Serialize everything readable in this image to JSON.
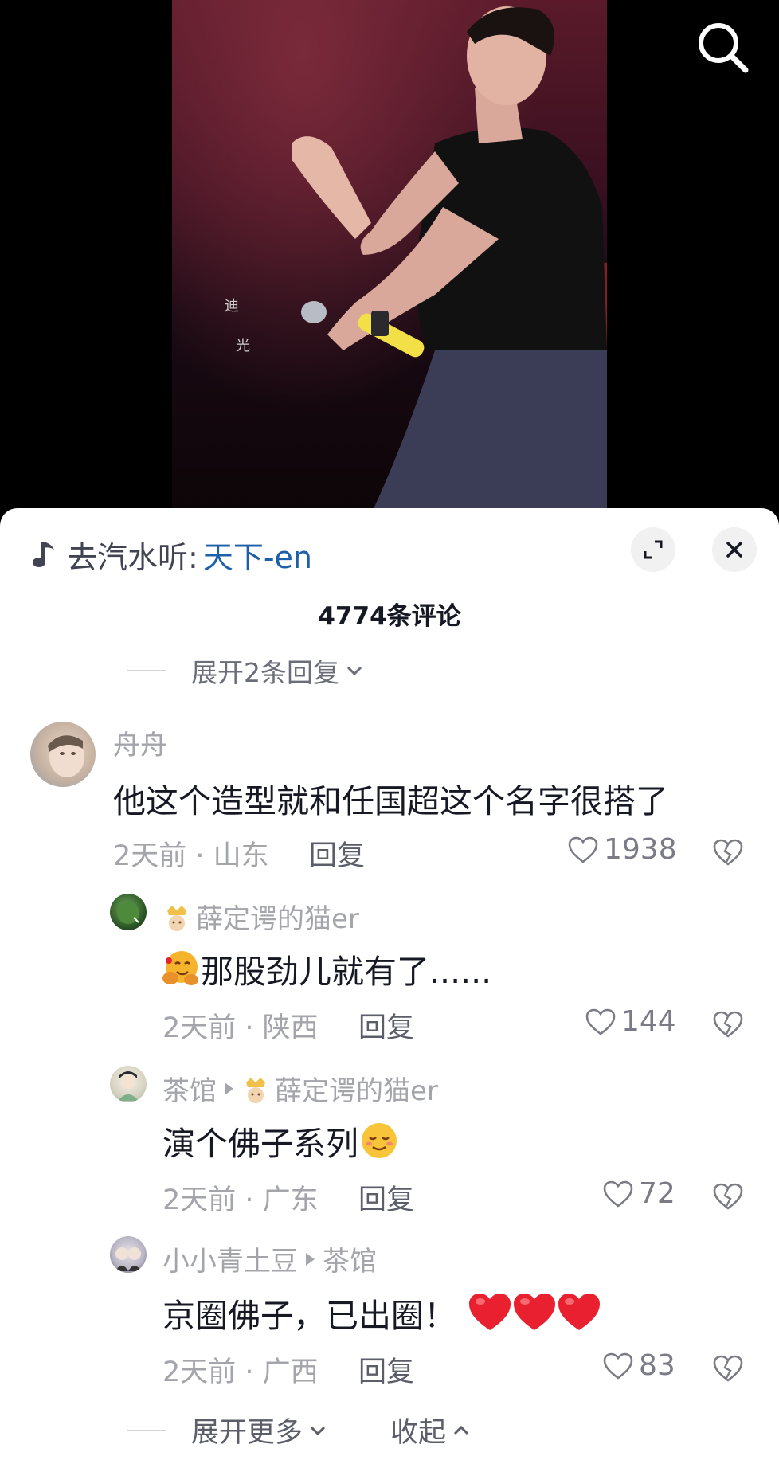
{
  "music": {
    "prefix": "去汽水听:",
    "song": "天下-en"
  },
  "comment_count": "4774条评论",
  "expand_replies_label": "展开2条回复",
  "comments": [
    {
      "username": "舟舟",
      "text": "他这个造型就和任国超这个名字很搭了",
      "meta": "2天前 · 山东",
      "reply": "回复",
      "likes": "1938"
    },
    {
      "username": "薛定谔的猫er",
      "text": "那股劲儿就有了......",
      "meta": "2天前 · 陕西",
      "reply": "回复",
      "likes": "144"
    },
    {
      "username": "茶馆",
      "reply_to": "薛定谔的猫er",
      "text": "演个佛子系列",
      "meta": "2天前 · 广东",
      "reply": "回复",
      "likes": "72"
    },
    {
      "username": "小小青土豆",
      "reply_to": "茶馆",
      "text": "京圈佛子，已出圈！",
      "meta": "2天前 · 广西",
      "reply": "回复",
      "likes": "83"
    }
  ],
  "footer": {
    "expand_more": "展开更多",
    "collapse": "收起"
  },
  "colors": {
    "link_blue": "#1d5fa8",
    "muted_text": "#a4a5ab",
    "heart_red": "#e8202f"
  }
}
